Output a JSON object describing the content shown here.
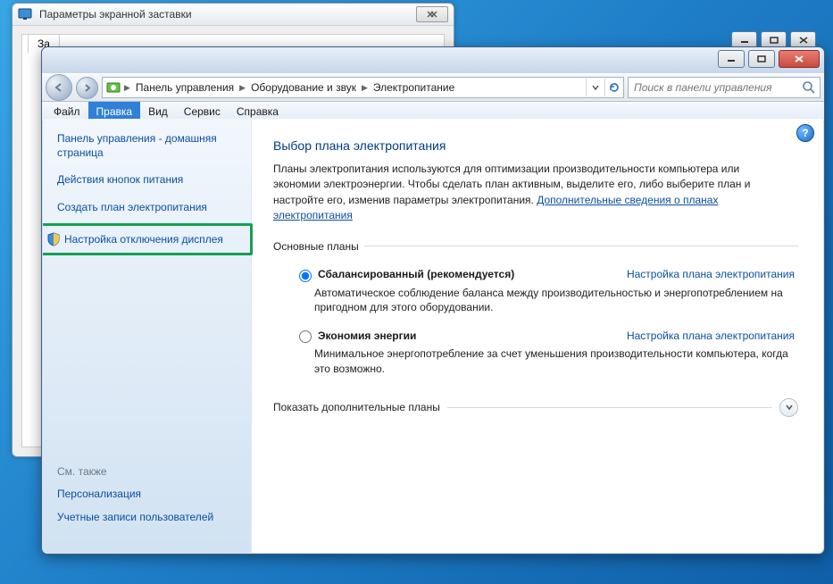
{
  "bg_parent_controls": {
    "min": "minimize",
    "max": "maximize",
    "close": "close"
  },
  "screensaver": {
    "title": "Параметры экранной заставки",
    "tab": "За"
  },
  "nav": {
    "crumbs": [
      "Панель управления",
      "Оборудование и звук",
      "Электропитание"
    ]
  },
  "search": {
    "placeholder": "Поиск в панели управления"
  },
  "menubar": {
    "items": [
      "Файл",
      "Правка",
      "Вид",
      "Сервис",
      "Справка"
    ],
    "selected_index": 1
  },
  "sidebar": {
    "tasks": [
      "Панель управления - домашняя страница",
      "Действия кнопок питания",
      "Создать план электропитания",
      "Настройка отключения дисплея"
    ],
    "highlight_index": 3,
    "see_also_label": "См. также",
    "see_also": [
      "Персонализация",
      "Учетные записи пользователей"
    ]
  },
  "main": {
    "heading": "Выбор плана электропитания",
    "intro_text": "Планы электропитания используются для оптимизации производительности компьютера или экономии электроэнергии. Чтобы сделать план активным, выделите его, либо выберите план и настройте его, изменив параметры электропитания. ",
    "intro_link": "Дополнительные сведения о планах электропитания",
    "group_label": "Основные планы",
    "plans": [
      {
        "name": "Сбалансированный (рекомендуется)",
        "checked": true,
        "config": "Настройка плана электропитания",
        "desc": "Автоматическое соблюдение баланса между производительностью и энергопотреблением на пригодном для этого оборудовании."
      },
      {
        "name": "Экономия энергии",
        "checked": false,
        "config": "Настройка плана электропитания",
        "desc": "Минимальное энергопотребление за счет уменьшения производительности компьютера, когда это возможно."
      }
    ],
    "extra_label": "Показать дополнительные планы"
  }
}
